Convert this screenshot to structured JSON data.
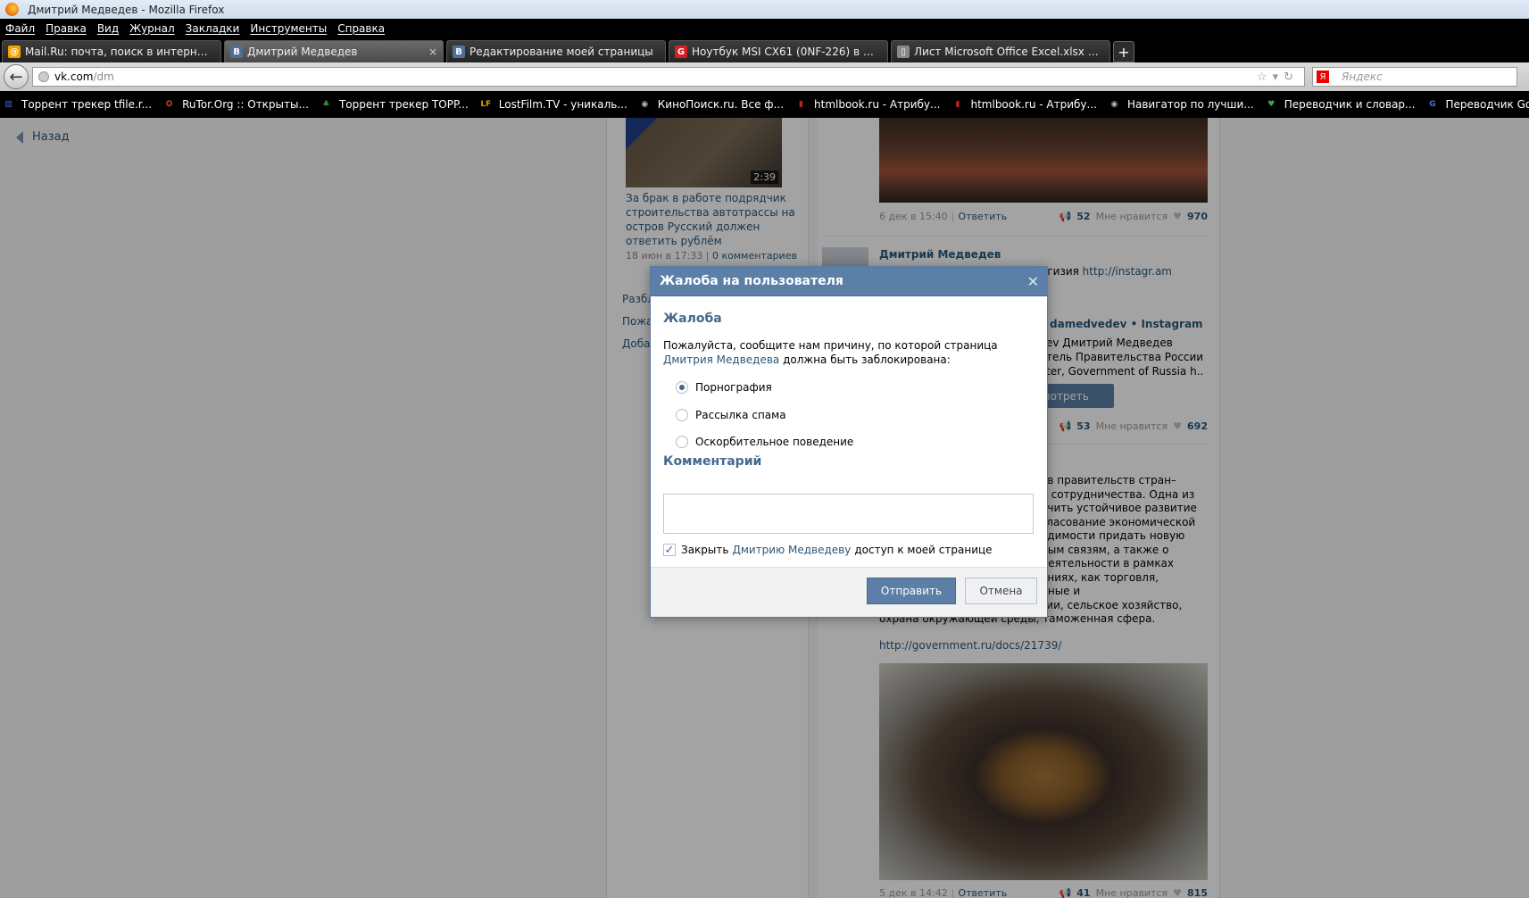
{
  "window": {
    "title": "Дмитрий Медведев - Mozilla Firefox"
  },
  "menu": [
    "Файл",
    "Правка",
    "Вид",
    "Журнал",
    "Закладки",
    "Инструменты",
    "Справка"
  ],
  "tabs": [
    {
      "label": "Mail.Ru: почта, поиск в интернете, н...",
      "icon": "mailru-icon",
      "iconText": "@",
      "iconColor": "#f5a100",
      "active": false,
      "close": ""
    },
    {
      "label": "Дмитрий Медведев",
      "icon": "vk-icon",
      "iconText": "B",
      "iconColor": "#4f6f96",
      "active": true,
      "close": "×"
    },
    {
      "label": "Редактирование моей страницы",
      "icon": "vk-icon",
      "iconText": "B",
      "iconColor": "#4f6f96",
      "active": false,
      "close": ""
    },
    {
      "label": "Ноутбук MSI CX61 (0NF-226) в Регар...",
      "icon": "regard-icon",
      "iconText": "G",
      "iconColor": "#d32020",
      "active": false,
      "close": ""
    },
    {
      "label": "Лист Microsoft Office Excel.xlsx — RG...",
      "icon": "document-icon",
      "iconText": "▯",
      "iconColor": "#888888",
      "active": false,
      "close": ""
    }
  ],
  "nav": {
    "url_host": "vk.com",
    "url_path": "/dm",
    "search_placeholder": "Яндекс",
    "search_logo": "Я"
  },
  "bookmarks": [
    {
      "label": "Торрент трекер tfile.r...",
      "iconText": "▥",
      "iconColor": "#3a6fcf"
    },
    {
      "label": "RuTor.Org :: Открыты...",
      "iconText": "✪",
      "iconColor": "#d24a1a"
    },
    {
      "label": "Торрент трекер TOPP...",
      "iconText": "♣",
      "iconColor": "#2e9c2e"
    },
    {
      "label": "LostFilm.TV - уникаль...",
      "iconText": "LF",
      "iconColor": "#e0a000"
    },
    {
      "label": "КиноПоиск.ru. Все ф...",
      "iconText": "◉",
      "iconColor": "#bbbbbb"
    },
    {
      "label": "htmlbook.ru - Атрибу...",
      "iconText": "▮",
      "iconColor": "#c02020"
    },
    {
      "label": "htmlbook.ru - Атрибу...",
      "iconText": "▮",
      "iconColor": "#c02020"
    },
    {
      "label": "Навигатор по лучши...",
      "iconText": "◉",
      "iconColor": "#bbbbbb"
    },
    {
      "label": "Переводчик и словар...",
      "iconText": "♥",
      "iconColor": "#3fa34d"
    },
    {
      "label": "Переводчик Google",
      "iconText": "G",
      "iconColor": "#3b7bd8"
    }
  ],
  "page": {
    "back": "Назад",
    "video": {
      "duration": "2:39",
      "title": "За брак в работе подрядчик строительства автотрассы на остров Русский должен ответить рублём",
      "date": "18 июн в 17:33",
      "comments": "0 комментариев"
    },
    "side_links": [
      "Разбл",
      "Пожа",
      "Доба"
    ],
    "post1": {
      "date": "6 дек в 15:40",
      "reply": "Ответить",
      "reposts": "52",
      "like_label": "Мне нравится",
      "likes": "970"
    },
    "post2": {
      "author": "Дмитрий Медведев",
      "text_tail": "огизия",
      "link": "http://instagr.am",
      "ig_title": "damedvedev • Instagram",
      "ig_lines": [
        "ev Дмитрий Медведев",
        "тель Правительства России",
        "ter, Government of Russia h.."
      ],
      "button": "мотреть",
      "reposts": "53",
      "like_label": "Мне нравится",
      "likes": "692"
    },
    "post3": {
      "lines": [
        "ав правительств стран–",
        "и сотрудничества. Одна из",
        "ечить устойчивое развитие",
        "гласование экономической",
        "одимости придать новую",
        "ным связям, а также о",
        "деятельности в рамках",
        "ениях, как торговля,",
        "нные и",
        "гии, сельское хозяйство,",
        "охрана окружающей среды, таможенная сфера."
      ],
      "link": "http://government.ru/docs/21739/",
      "date": "5 дек в 14:42",
      "reply": "Ответить",
      "reposts": "41",
      "like_label": "Мне нравится",
      "likes": "815"
    }
  },
  "dialog": {
    "title": "Жалоба на пользователя",
    "close": "✕",
    "section_title": "Жалоба",
    "prompt_before": "Пожалуйста, сообщите нам причину, по которой страница ",
    "prompt_link": "Дмитрия Медведева",
    "prompt_after": " должна быть заблокирована:",
    "reasons": [
      {
        "label": "Порнография",
        "selected": true
      },
      {
        "label": "Рассылка спама",
        "selected": false
      },
      {
        "label": "Оскорбительное поведение",
        "selected": false
      }
    ],
    "comment_title": "Комментарий",
    "comment_value": "",
    "block_before": "Закрыть",
    "block_link": "Дмитрию Медведеву",
    "block_after": "доступ к моей странице",
    "block_checked": true,
    "send": "Отправить",
    "cancel": "Отмена"
  }
}
